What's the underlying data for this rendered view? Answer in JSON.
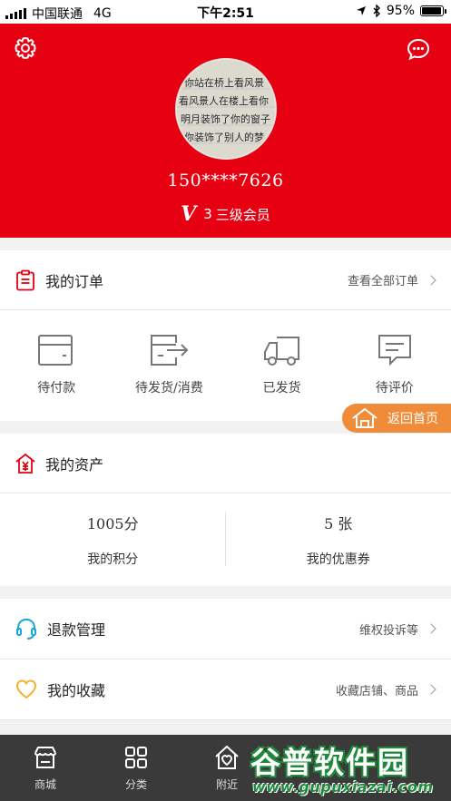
{
  "status_bar": {
    "carrier": "中国联通",
    "network": "4G",
    "time": "下午2:51",
    "battery": "95%"
  },
  "profile": {
    "phone": "150****7626",
    "level_badge": "V",
    "level_num": "3",
    "level_text": "三级会员",
    "avatar_text": [
      "你站在桥上看风景",
      "看风景人在楼上看你",
      "明月装饰了你的窗子",
      "你装饰了别人的梦"
    ]
  },
  "orders": {
    "title": "我的订单",
    "view_all": "查看全部订单",
    "items": [
      {
        "label": "待付款",
        "icon": "wallet-icon"
      },
      {
        "label": "待发货/消费",
        "icon": "pending-ship-icon"
      },
      {
        "label": "已发货",
        "icon": "truck-icon"
      },
      {
        "label": "待评价",
        "icon": "review-icon"
      }
    ]
  },
  "assets": {
    "title": "我的资产",
    "points_value": "1005分",
    "points_label": "我的积分",
    "coupons_value": "5 张",
    "coupons_label": "我的优惠券"
  },
  "refund": {
    "title": "退款管理",
    "more": "维权投诉等"
  },
  "favorites": {
    "title": "我的收藏",
    "more": "收藏店铺、商品"
  },
  "back_home": "返回首页",
  "tabs": [
    {
      "label": "商城",
      "icon": "store-icon"
    },
    {
      "label": "分类",
      "icon": "grid-icon"
    },
    {
      "label": "附近",
      "icon": "nearby-icon"
    }
  ],
  "watermark": {
    "main": "谷普软件园",
    "sub": "www.gupuxiazai.com"
  },
  "colors": {
    "header": "#e60012",
    "back_home": "#f08b3a",
    "tabbar": "#3a3a3a"
  }
}
